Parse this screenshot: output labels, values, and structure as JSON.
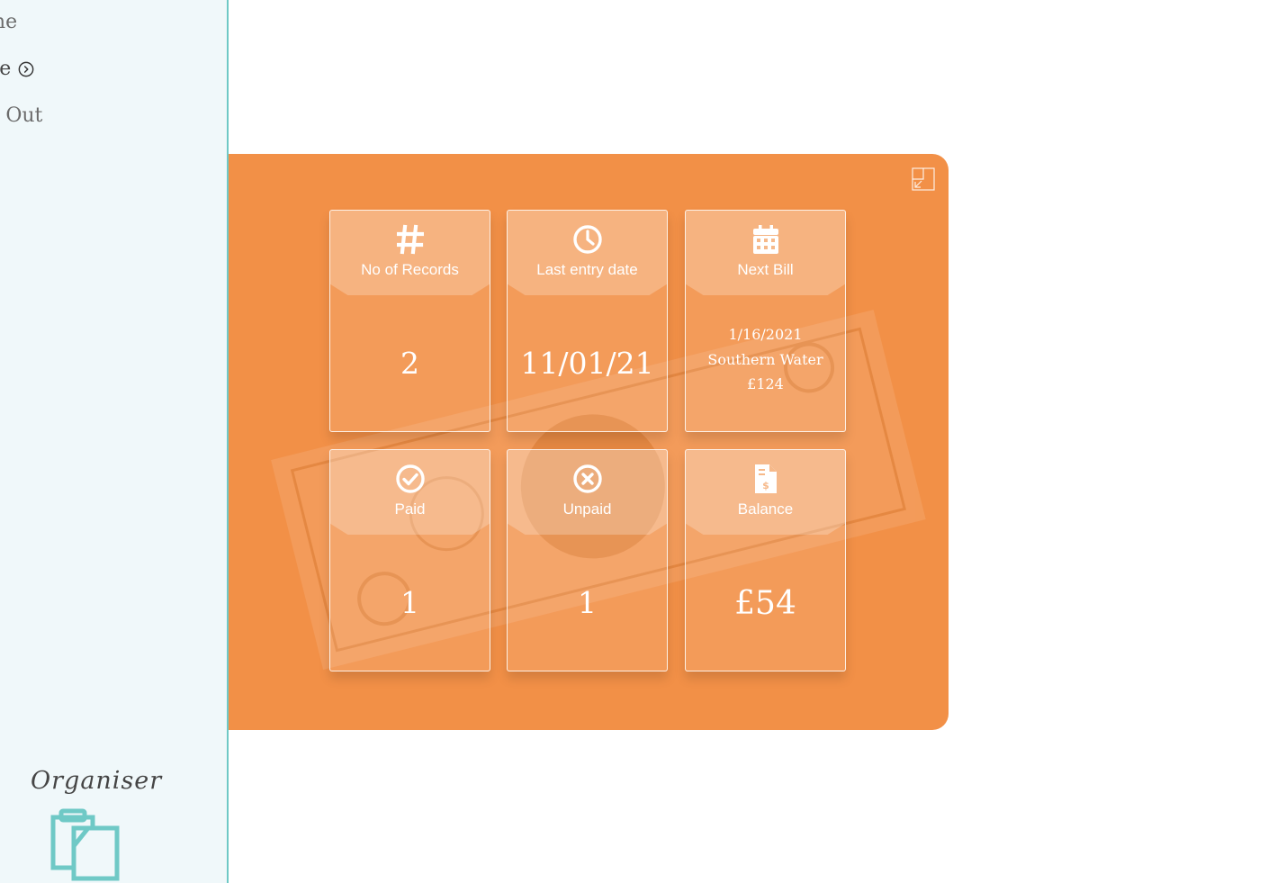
{
  "sidebar": {
    "nav": [
      {
        "label": "ome"
      },
      {
        "label": "age"
      },
      {
        "label": "og Out"
      }
    ],
    "logo_text": "Organiser",
    "accent": "#6fc9c6"
  },
  "panel": {
    "background_color": "#f29047",
    "collapse_icon": "collapse-icon",
    "cards": [
      {
        "icon": "hash-icon",
        "title": "No of Records",
        "value": "2"
      },
      {
        "icon": "clock-icon",
        "title": "Last entry date",
        "value": "11/01/21"
      },
      {
        "icon": "calendar-icon",
        "title": "Next Bill",
        "bill": {
          "date": "1/16/2021",
          "payee": "Southern Water",
          "amount": "£124"
        }
      },
      {
        "icon": "check-circle-icon",
        "title": "Paid",
        "value": "1"
      },
      {
        "icon": "x-circle-icon",
        "title": "Unpaid",
        "value": "1"
      },
      {
        "icon": "invoice-icon",
        "title": "Balance",
        "value": "£54"
      }
    ]
  }
}
